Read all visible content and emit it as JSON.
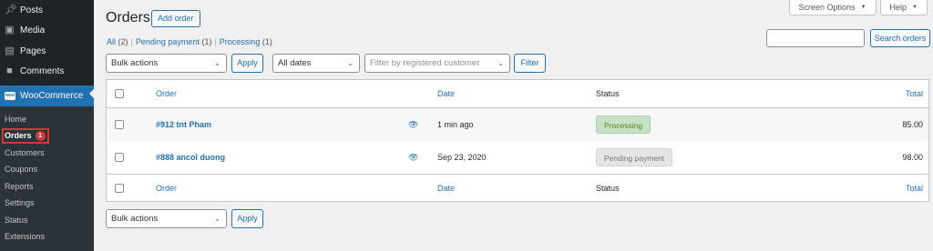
{
  "sidebar": {
    "items": [
      {
        "label": "Posts",
        "icon": "pin-icon"
      },
      {
        "label": "Media",
        "icon": "media-icon"
      },
      {
        "label": "Pages",
        "icon": "pages-icon"
      },
      {
        "label": "Comments",
        "icon": "comment-icon"
      }
    ],
    "woocommerce": {
      "label": "WooCommerce",
      "icon_text": "woo"
    },
    "submenu": [
      "Home",
      "Orders",
      "Customers",
      "Coupons",
      "Reports",
      "Settings",
      "Status",
      "Extensions"
    ],
    "orders_count": "1"
  },
  "screen_meta": {
    "screen_options": "Screen Options",
    "help": "Help"
  },
  "header": {
    "title": "Orders",
    "add_order": "Add order"
  },
  "filters": {
    "all_label": "All",
    "all_count": "(2)",
    "pending_label": "Pending payment",
    "pending_count": "(1)",
    "processing_label": "Processing",
    "processing_count": "(1)"
  },
  "search": {
    "placeholder": "",
    "button": "Search orders"
  },
  "bulk": {
    "actions_value": "Bulk actions",
    "apply": "Apply"
  },
  "date_filter": "All dates",
  "customer_filter": "Filter by registered customer",
  "filter_button": "Filter",
  "table": {
    "columns": {
      "order": "Order",
      "date": "Date",
      "status": "Status",
      "total": "Total"
    },
    "rows": [
      {
        "order": "#912 tnt Pham",
        "date": "1 min ago",
        "status": "Processing",
        "total": "85.00"
      },
      {
        "order": "#888 ancol duong",
        "date": "Sep 23, 2020",
        "status": "Pending payment",
        "total": "98.00"
      }
    ]
  },
  "bottom_bulk": {
    "actions_value": "Bulk actions",
    "apply": "Apply"
  },
  "colors": {
    "accent": "#2271b1",
    "sidebar_bg": "#1d2327",
    "processing_bg": "#c6e1c6",
    "processing_text": "#5b841b",
    "pending_bg": "#e5e5e5",
    "highlight_red": "#d63638"
  }
}
